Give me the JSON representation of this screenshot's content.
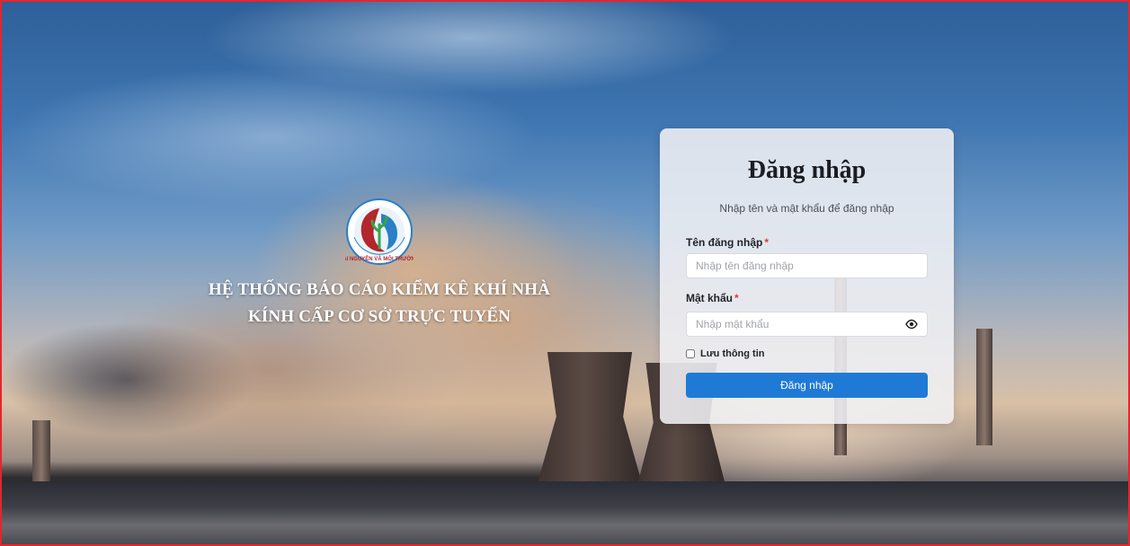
{
  "brand": {
    "logo_text": "TÀI NGUYÊN VÀ MÔI TRƯỜNG",
    "title_line1": "HỆ THỐNG BÁO CÁO KIỂM KÊ KHÍ NHÀ",
    "title_line2": "KÍNH CẤP CƠ SỞ TRỰC TUYẾN"
  },
  "login": {
    "title": "Đăng nhập",
    "subtitle": "Nhập tên và mật khẩu để đăng nhập",
    "username_label": "Tên đăng nhập",
    "username_placeholder": "Nhập tên đăng nhập",
    "username_value": "",
    "password_label": "Mật khẩu",
    "password_placeholder": "Nhập mật khẩu",
    "password_value": "",
    "required_mark": "*",
    "remember_label": "Lưu thông tin",
    "remember_checked": false,
    "submit_label": "Đăng nhập"
  },
  "icons": {
    "password_toggle": "eye-icon",
    "logo": "ministry-logo-icon"
  },
  "colors": {
    "primary": "#1f7ad6",
    "required": "#e03a3a",
    "frame_border": "#e3262e",
    "logo_red": "#b3262c",
    "logo_blue": "#2a7fc7",
    "logo_green": "#3aa34a"
  }
}
